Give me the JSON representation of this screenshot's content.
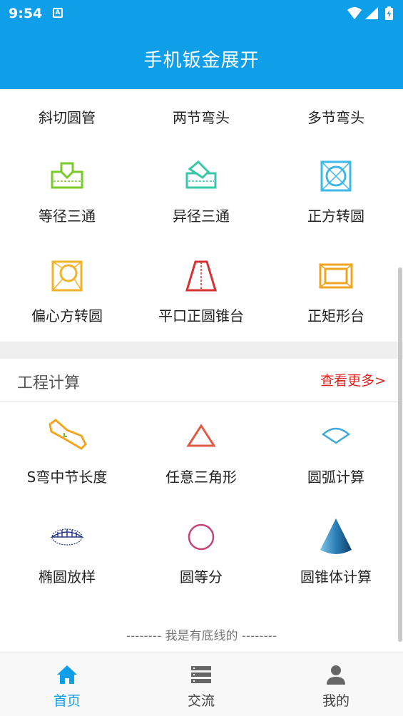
{
  "status_bar": {
    "time": "9:54",
    "notification_icon": "A"
  },
  "app_bar": {
    "title": "手机钣金展开"
  },
  "unfold": {
    "items": [
      {
        "label": "斜切圆管",
        "icon": "oblique-cut-pipe-icon"
      },
      {
        "label": "两节弯头",
        "icon": "two-section-elbow-icon"
      },
      {
        "label": "多节弯头",
        "icon": "multi-section-elbow-icon"
      },
      {
        "label": "等径三通",
        "icon": "equal-tee-icon"
      },
      {
        "label": "异径三通",
        "icon": "reducing-tee-icon"
      },
      {
        "label": "正方转圆",
        "icon": "square-to-round-icon"
      },
      {
        "label": "偏心方转圆",
        "icon": "eccentric-square-to-round-icon"
      },
      {
        "label": "平口正圆锥台",
        "icon": "truncated-cone-icon"
      },
      {
        "label": "正矩形台",
        "icon": "rectangular-frustum-icon"
      }
    ]
  },
  "calc": {
    "title": "工程计算",
    "more": "查看更多>",
    "items": [
      {
        "label": "S弯中节长度",
        "icon": "s-bend-icon"
      },
      {
        "label": "任意三角形",
        "icon": "triangle-icon"
      },
      {
        "label": "圆弧计算",
        "icon": "arc-icon"
      },
      {
        "label": "椭圆放样",
        "icon": "ellipse-icon"
      },
      {
        "label": "圆等分",
        "icon": "circle-icon"
      },
      {
        "label": "圆锥体计算",
        "icon": "cone-icon"
      }
    ]
  },
  "footer_note": "-------- 我是有底线的 --------",
  "bottom_nav": {
    "items": [
      {
        "label": "首页",
        "icon": "home-icon",
        "active": true
      },
      {
        "label": "交流",
        "icon": "list-icon",
        "active": false
      },
      {
        "label": "我的",
        "icon": "person-icon",
        "active": false
      }
    ]
  },
  "colors": {
    "primary": "#0f9fe8",
    "accent_red": "#e0241f"
  }
}
